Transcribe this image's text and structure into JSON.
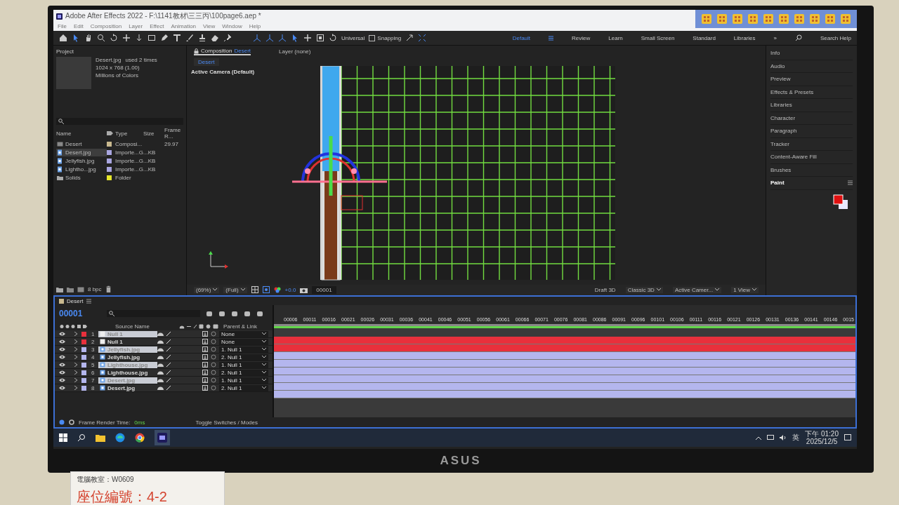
{
  "window": {
    "title": "Adobe After Effects 2022 - F:\\1141教材\\三三丙\\100page6.aep *"
  },
  "menu": [
    "File",
    "Edit",
    "Composition",
    "Layer",
    "Effect",
    "Animation",
    "View",
    "Window",
    "Help"
  ],
  "toolbar": {
    "axis_mode": "Universal",
    "snapping": {
      "label": "Snapping",
      "checked": false
    }
  },
  "workspaces": [
    {
      "label": "Default",
      "selected": true
    },
    {
      "label": "Review",
      "selected": false
    },
    {
      "label": "Learn",
      "selected": false
    },
    {
      "label": "Small Screen",
      "selected": false
    },
    {
      "label": "Standard",
      "selected": false
    },
    {
      "label": "Libraries",
      "selected": false
    }
  ],
  "workspace_overflow": "»",
  "search_help": "Search Help",
  "project": {
    "title": "Project",
    "item": {
      "name": "Desert.jpg",
      "usage": "used 2 times",
      "dimensions": "1024 x 768 (1.00)",
      "colors": "Millions of Colors"
    },
    "columns": [
      "Name",
      "Type",
      "Size",
      "Frame R..."
    ],
    "items": [
      {
        "kind": "composition",
        "name": "Desert",
        "color": "#c9b98f",
        "type": "Composi...",
        "frame_rate": "29.97",
        "selected": false
      },
      {
        "kind": "image",
        "name": "Desert.jpg",
        "color": "#a9a6e0",
        "type": "Importe...G",
        "size": "...KB",
        "selected": true
      },
      {
        "kind": "image",
        "name": "Jellyfish.jpg",
        "color": "#a9a6e0",
        "type": "Importe...G",
        "size": "...KB",
        "selected": false
      },
      {
        "kind": "image",
        "name": "Lightho...jpg",
        "color": "#a9a6e0",
        "type": "Importe...G",
        "size": "...KB",
        "selected": false
      },
      {
        "kind": "folder",
        "name": "Solids",
        "color": "#e6e62a",
        "type": "Folder",
        "selected": false
      }
    ],
    "bpc": "8 bpc"
  },
  "composition": {
    "tab": "Composition",
    "tab_name": "Desert",
    "layer_tab": "Layer (none)",
    "breadcrumb": "Desert",
    "view_label": "Active Camera (Default)",
    "zoom": "(69%)",
    "resolution": "(Full)",
    "exposure": "+0.0",
    "time": "00001",
    "draft": "Draft 3D",
    "renderer": "Classic 3D",
    "camera": "Active Camer...",
    "views": "1 View"
  },
  "panels": [
    {
      "label": "Info",
      "expanded": false
    },
    {
      "label": "Audio",
      "expanded": false
    },
    {
      "label": "Preview",
      "expanded": false
    },
    {
      "label": "Effects & Presets",
      "expanded": false
    },
    {
      "label": "Libraries",
      "expanded": false
    },
    {
      "label": "Character",
      "expanded": false
    },
    {
      "label": "Paragraph",
      "expanded": false
    },
    {
      "label": "Tracker",
      "expanded": false
    },
    {
      "label": "Content-Aware Fill",
      "expanded": false
    },
    {
      "label": "Brushes",
      "expanded": false
    },
    {
      "label": "Paint",
      "expanded": true
    }
  ],
  "timeline": {
    "tab": "Desert",
    "timecode": "00001",
    "source_column": "Source Name",
    "parent_column": "Parent & Link",
    "ruler": [
      "00006",
      "00011",
      "00016",
      "00021",
      "00026",
      "00031",
      "00036",
      "00041",
      "00046",
      "00051",
      "00056",
      "00061",
      "00066",
      "00071",
      "00076",
      "00081",
      "00086",
      "00091",
      "00096",
      "00101",
      "00106",
      "00111",
      "00116",
      "00121",
      "00126",
      "00131",
      "00136",
      "00141",
      "00146",
      "0015"
    ],
    "layers": [
      {
        "number": "1",
        "kind": "null",
        "name": "Null 1",
        "color": "#e8303c",
        "parent": "None",
        "selected": true
      },
      {
        "number": "2",
        "kind": "null",
        "name": "Null 1",
        "color": "#e8303c",
        "parent": "None",
        "selected": false
      },
      {
        "number": "3",
        "kind": "image",
        "name": "Jellyfish.jpg",
        "color": "#b4b6ee",
        "parent": "1. Null 1",
        "selected": true
      },
      {
        "number": "4",
        "kind": "image",
        "name": "Jellyfish.jpg",
        "color": "#b4b6ee",
        "parent": "2. Null 1",
        "selected": false
      },
      {
        "number": "5",
        "kind": "image",
        "name": "Lighthouse.jpg",
        "color": "#b4b6ee",
        "parent": "1. Null 1",
        "selected": true
      },
      {
        "number": "6",
        "kind": "image",
        "name": "Lighthouse.jpg",
        "color": "#b4b6ee",
        "parent": "2. Null 1",
        "selected": false
      },
      {
        "number": "7",
        "kind": "image",
        "name": "Desert.jpg",
        "color": "#b4b6ee",
        "parent": "1. Null 1",
        "selected": true
      },
      {
        "number": "8",
        "kind": "image",
        "name": "Desert.jpg",
        "color": "#b4b6ee",
        "parent": "2. Null 1",
        "selected": false
      }
    ],
    "render_label": "Frame Render Time:",
    "render_time": "0ms",
    "toggle": "Toggle Switches / Modes"
  },
  "tray": {
    "ime": "英",
    "time": "下午 01:20",
    "date": "2025/12/5"
  },
  "monitor": {
    "brand": "ASUS"
  },
  "desk_label": {
    "room": "電腦教室：W0609",
    "seat": "座位編號：4-2"
  }
}
